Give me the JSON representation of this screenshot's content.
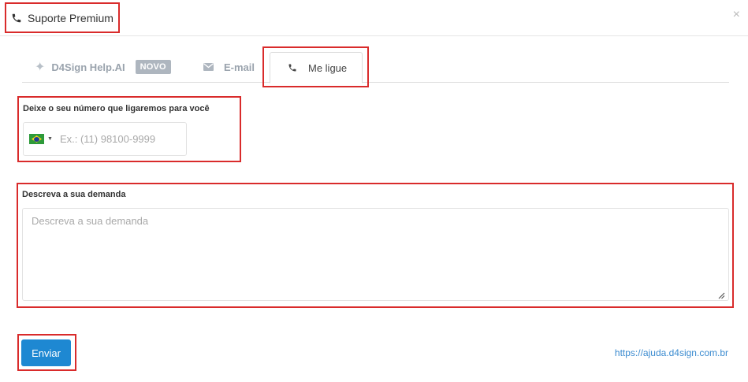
{
  "header": {
    "title": "Suporte Premium",
    "close_glyph": "×",
    "title_icon": "phone-icon",
    "close_icon": "close-icon"
  },
  "tabs": [
    {
      "label": "D4Sign Help.AI",
      "icon": "sparkle-icon",
      "badge": "NOVO",
      "active": false
    },
    {
      "label": "E-mail",
      "icon": "envelope-icon",
      "active": false
    },
    {
      "label": "Me ligue",
      "icon": "phone-icon",
      "active": true
    }
  ],
  "phone": {
    "label": "Deixe o seu número que ligaremos para você",
    "placeholder": "Ex.: (11) 98100-9999",
    "value": "",
    "country_flag": "brazil-flag-icon"
  },
  "description": {
    "label": "Descreva a sua demanda",
    "placeholder": "Descreva a sua demanda",
    "value": ""
  },
  "actions": {
    "send_label": "Enviar"
  },
  "footer": {
    "help_link": "https://ajuda.d4sign.com.br"
  },
  "colors": {
    "accent": "#1e88d2",
    "highlight_border": "#d92b2b",
    "link": "#3b8bd0",
    "badge_bg": "#aeb6bf"
  }
}
